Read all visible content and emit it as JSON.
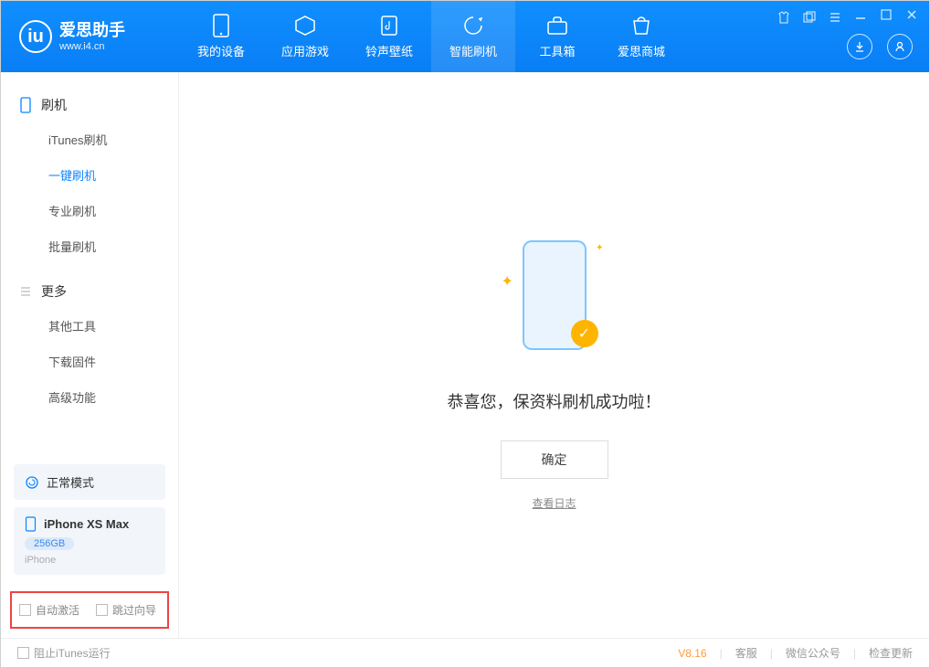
{
  "app": {
    "title": "爱思助手",
    "subtitle": "www.i4.cn"
  },
  "nav": {
    "items": [
      {
        "label": "我的设备"
      },
      {
        "label": "应用游戏"
      },
      {
        "label": "铃声壁纸"
      },
      {
        "label": "智能刷机"
      },
      {
        "label": "工具箱"
      },
      {
        "label": "爱思商城"
      }
    ]
  },
  "sidebar": {
    "group1_title": "刷机",
    "group1_items": [
      {
        "label": "iTunes刷机"
      },
      {
        "label": "一键刷机"
      },
      {
        "label": "专业刷机"
      },
      {
        "label": "批量刷机"
      }
    ],
    "group2_title": "更多",
    "group2_items": [
      {
        "label": "其他工具"
      },
      {
        "label": "下载固件"
      },
      {
        "label": "高级功能"
      }
    ],
    "mode_label": "正常模式",
    "device_name": "iPhone XS Max",
    "device_storage": "256GB",
    "device_type": "iPhone",
    "check1": "自动激活",
    "check2": "跳过向导"
  },
  "main": {
    "success_msg": "恭喜您，保资料刷机成功啦！",
    "ok_button": "确定",
    "view_log": "查看日志"
  },
  "footer": {
    "block_itunes": "阻止iTunes运行",
    "version": "V8.16",
    "link1": "客服",
    "link2": "微信公众号",
    "link3": "检查更新"
  }
}
